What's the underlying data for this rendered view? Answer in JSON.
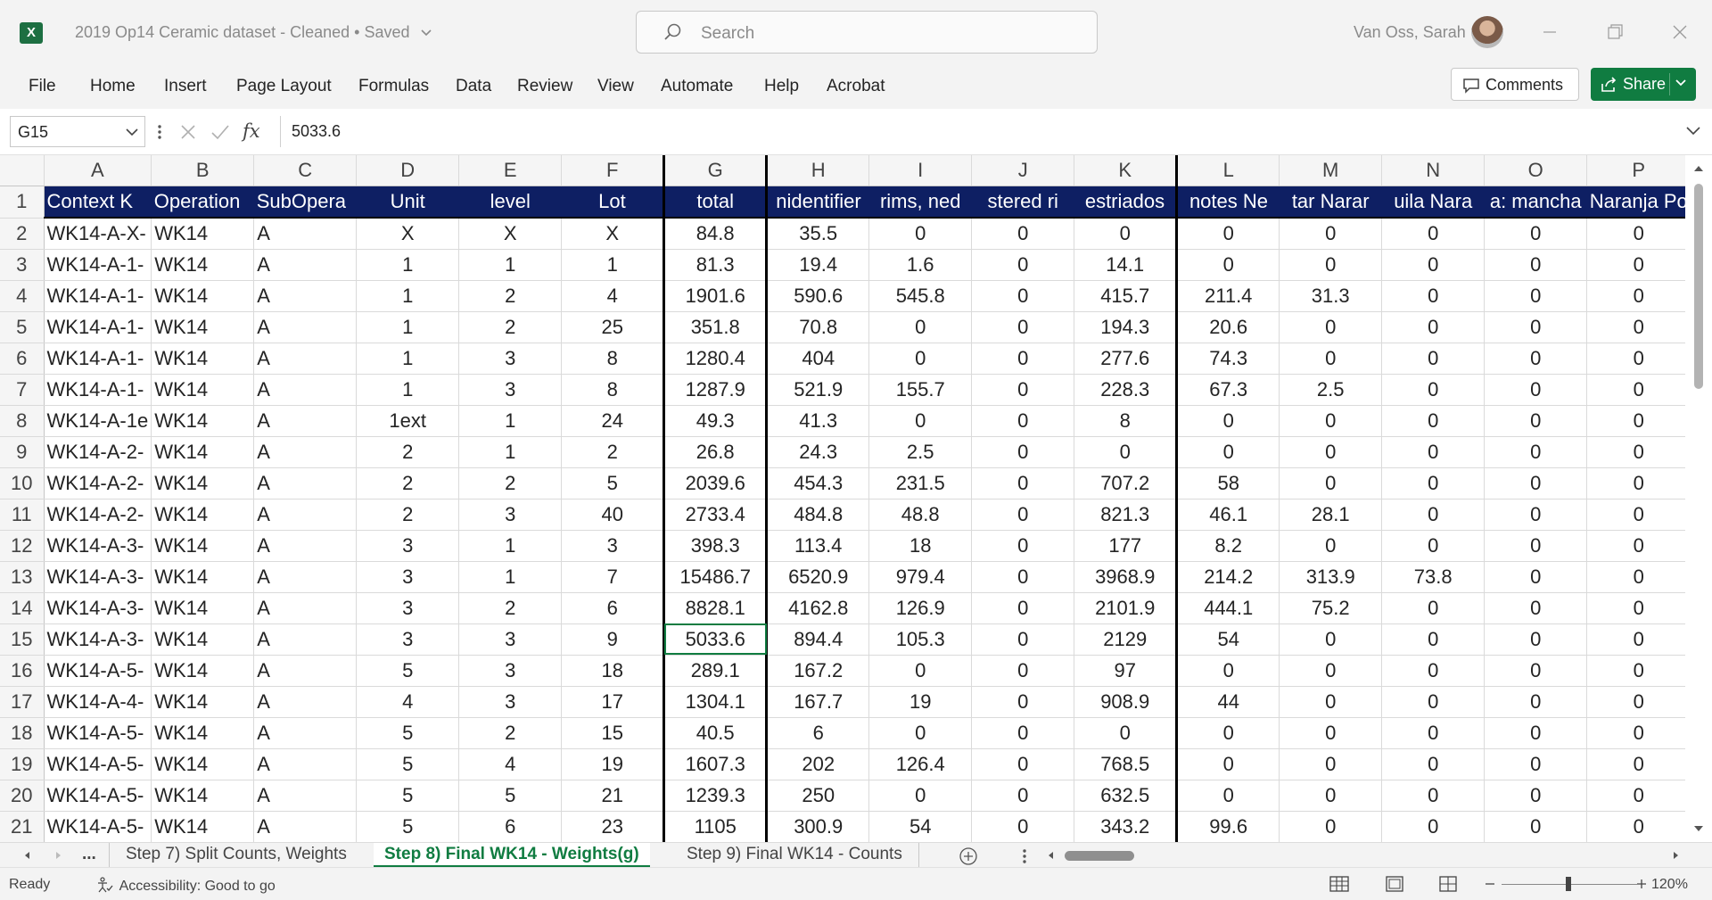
{
  "app": {
    "logo_letter": "X"
  },
  "titlebar": {
    "document_title": "2019 Op14  Ceramic dataset - Cleaned  •  Saved",
    "search_placeholder": "Search",
    "user_name": "Van Oss, Sarah"
  },
  "menu": {
    "items": [
      "File",
      "Home",
      "Insert",
      "Page Layout",
      "Formulas",
      "Data",
      "Review",
      "View",
      "Automate",
      "Help",
      "Acrobat"
    ],
    "comments_label": "Comments",
    "share_label": "Share"
  },
  "formula_bar": {
    "name_box": "G15",
    "formula": "5033.6",
    "fx_label": "fx"
  },
  "grid": {
    "columns": [
      "A",
      "B",
      "C",
      "D",
      "E",
      "F",
      "G",
      "H",
      "I",
      "J",
      "K",
      "L",
      "M",
      "N",
      "O",
      "P"
    ],
    "header_row": [
      "Context K",
      "Operation",
      "SubOpera",
      "Unit",
      "level",
      "Lot",
      "total",
      "nidentifier",
      "rims, ned",
      "stered ri",
      "estriados",
      "notes Ne",
      "tar Narar",
      "uila Nara",
      "a: mancha",
      "Naranja Po"
    ],
    "rows": [
      [
        "WK14-A-X-",
        "WK14",
        "A",
        "X",
        "X",
        "X",
        "84.8",
        "35.5",
        "0",
        "0",
        "0",
        "0",
        "0",
        "0",
        "0",
        "0"
      ],
      [
        "WK14-A-1-",
        "WK14",
        "A",
        "1",
        "1",
        "1",
        "81.3",
        "19.4",
        "1.6",
        "0",
        "14.1",
        "0",
        "0",
        "0",
        "0",
        "0"
      ],
      [
        "WK14-A-1-",
        "WK14",
        "A",
        "1",
        "2",
        "4",
        "1901.6",
        "590.6",
        "545.8",
        "0",
        "415.7",
        "211.4",
        "31.3",
        "0",
        "0",
        "0"
      ],
      [
        "WK14-A-1-",
        "WK14",
        "A",
        "1",
        "2",
        "25",
        "351.8",
        "70.8",
        "0",
        "0",
        "194.3",
        "20.6",
        "0",
        "0",
        "0",
        "0"
      ],
      [
        "WK14-A-1-",
        "WK14",
        "A",
        "1",
        "3",
        "8",
        "1280.4",
        "404",
        "0",
        "0",
        "277.6",
        "74.3",
        "0",
        "0",
        "0",
        "0"
      ],
      [
        "WK14-A-1-",
        "WK14",
        "A",
        "1",
        "3",
        "8",
        "1287.9",
        "521.9",
        "155.7",
        "0",
        "228.3",
        "67.3",
        "2.5",
        "0",
        "0",
        "0"
      ],
      [
        "WK14-A-1e",
        "WK14",
        "A",
        "1ext",
        "1",
        "24",
        "49.3",
        "41.3",
        "0",
        "0",
        "8",
        "0",
        "0",
        "0",
        "0",
        "0"
      ],
      [
        "WK14-A-2-",
        "WK14",
        "A",
        "2",
        "1",
        "2",
        "26.8",
        "24.3",
        "2.5",
        "0",
        "0",
        "0",
        "0",
        "0",
        "0",
        "0"
      ],
      [
        "WK14-A-2-",
        "WK14",
        "A",
        "2",
        "2",
        "5",
        "2039.6",
        "454.3",
        "231.5",
        "0",
        "707.2",
        "58",
        "0",
        "0",
        "0",
        "0"
      ],
      [
        "WK14-A-2-",
        "WK14",
        "A",
        "2",
        "3",
        "40",
        "2733.4",
        "484.8",
        "48.8",
        "0",
        "821.3",
        "46.1",
        "28.1",
        "0",
        "0",
        "0"
      ],
      [
        "WK14-A-3-",
        "WK14",
        "A",
        "3",
        "1",
        "3",
        "398.3",
        "113.4",
        "18",
        "0",
        "177",
        "8.2",
        "0",
        "0",
        "0",
        "0"
      ],
      [
        "WK14-A-3-",
        "WK14",
        "A",
        "3",
        "1",
        "7",
        "15486.7",
        "6520.9",
        "979.4",
        "0",
        "3968.9",
        "214.2",
        "313.9",
        "73.8",
        "0",
        "0"
      ],
      [
        "WK14-A-3-",
        "WK14",
        "A",
        "3",
        "2",
        "6",
        "8828.1",
        "4162.8",
        "126.9",
        "0",
        "2101.9",
        "444.1",
        "75.2",
        "0",
        "0",
        "0"
      ],
      [
        "WK14-A-3-",
        "WK14",
        "A",
        "3",
        "3",
        "9",
        "5033.6",
        "894.4",
        "105.3",
        "0",
        "2129",
        "54",
        "0",
        "0",
        "0",
        "0"
      ],
      [
        "WK14-A-5-",
        "WK14",
        "A",
        "5",
        "3",
        "18",
        "289.1",
        "167.2",
        "0",
        "0",
        "97",
        "0",
        "0",
        "0",
        "0",
        "0"
      ],
      [
        "WK14-A-4-",
        "WK14",
        "A",
        "4",
        "3",
        "17",
        "1304.1",
        "167.7",
        "19",
        "0",
        "908.9",
        "44",
        "0",
        "0",
        "0",
        "0"
      ],
      [
        "WK14-A-5-",
        "WK14",
        "A",
        "5",
        "2",
        "15",
        "40.5",
        "6",
        "0",
        "0",
        "0",
        "0",
        "0",
        "0",
        "0",
        "0"
      ],
      [
        "WK14-A-5-",
        "WK14",
        "A",
        "5",
        "4",
        "19",
        "1607.3",
        "202",
        "126.4",
        "0",
        "768.5",
        "0",
        "0",
        "0",
        "0",
        "0"
      ],
      [
        "WK14-A-5-",
        "WK14",
        "A",
        "5",
        "5",
        "21",
        "1239.3",
        "250",
        "0",
        "0",
        "632.5",
        "0",
        "0",
        "0",
        "0",
        "0"
      ],
      [
        "WK14-A-5-",
        "WK14",
        "A",
        "5",
        "6",
        "23",
        "1105",
        "300.9",
        "54",
        "0",
        "343.2",
        "99.6",
        "0",
        "0",
        "0",
        "0"
      ]
    ],
    "header_bg": "#0e1f63"
  },
  "sheet_tabs": {
    "overflow": "...",
    "tabs": [
      "Step 7) Split Counts, Weights",
      "Step 8) Final WK14 - Weights(g)",
      "Step 9) Final WK14 - Counts"
    ],
    "active_index": 1
  },
  "status": {
    "ready": "Ready",
    "accessibility": "Accessibility: Good to go",
    "zoom": "120%"
  },
  "colors": {
    "accent": "#107c41",
    "selected_cell": "G15"
  }
}
